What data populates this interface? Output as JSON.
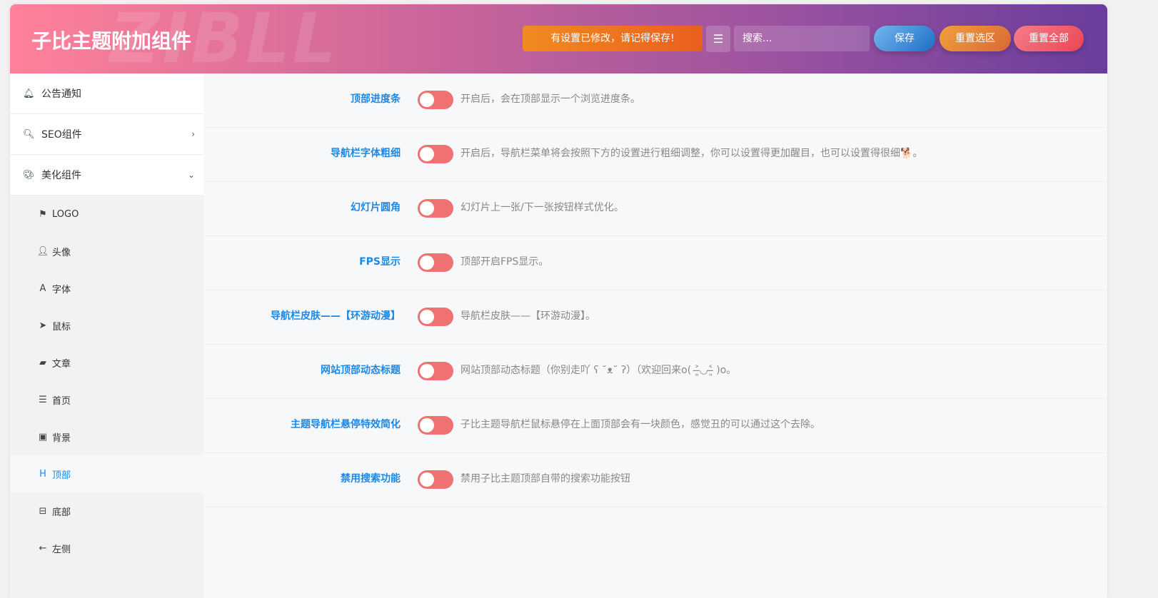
{
  "header": {
    "title": "子比主题附加组件",
    "watermark": "ZIBLL",
    "notice": "有设置已修改，请记得保存!",
    "search_placeholder": "搜索...",
    "save": "保存",
    "reset_section": "重置选区",
    "reset_all": "重置全部"
  },
  "sidebar": {
    "top": [
      {
        "label": "公告通知",
        "icon": "bell-icon"
      },
      {
        "label": "SEO组件",
        "icon": "search-icon"
      },
      {
        "label": "美化组件",
        "icon": "palette-icon"
      }
    ],
    "sub": [
      {
        "label": "LOGO",
        "icon": "flag-icon"
      },
      {
        "label": "头像",
        "icon": "user-icon"
      },
      {
        "label": "字体",
        "icon": "font-icon"
      },
      {
        "label": "鼠标",
        "icon": "cursor-icon"
      },
      {
        "label": "文章",
        "icon": "book-icon"
      },
      {
        "label": "首页",
        "icon": "indent-icon"
      },
      {
        "label": "背景",
        "icon": "image-icon"
      },
      {
        "label": "顶部",
        "icon": "header-icon",
        "active": true
      },
      {
        "label": "底部",
        "icon": "footer-icon"
      },
      {
        "label": "左侧",
        "icon": "arrow-left-icon"
      }
    ]
  },
  "settings": [
    {
      "label": "顶部进度条",
      "desc": "开启后，会在顶部显示一个浏览进度条。",
      "on": false
    },
    {
      "label": "导航栏字体粗细",
      "desc": "开启后，导航栏菜单将会按照下方的设置进行粗细调整，你可以设置得更加醒目，也可以设置得很细🐕。",
      "on": false
    },
    {
      "label": "幻灯片圆角",
      "desc": "幻灯片上一张/下一张按钮样式优化。",
      "on": false
    },
    {
      "label": "FPS显示",
      "desc": "顶部开启FPS显示。",
      "on": false
    },
    {
      "label": "导航栏皮肤——【环游动漫】",
      "desc": "导航栏皮肤——【环游动漫】。",
      "on": false
    },
    {
      "label": "网站顶部动态标题",
      "desc": "网站顶部动态标题（你别走吖 ʕ ˘ᴥ˘ ʔ）（欢迎回来o( ˃̶͈◡˂̶͈ )o。",
      "on": false
    },
    {
      "label": "主题导航栏悬停特效简化",
      "desc": "子比主题导航栏鼠标悬停在上面顶部会有一块颜色，感觉丑的可以通过这个去除。",
      "on": false
    },
    {
      "label": "禁用搜索功能",
      "desc": "禁用子比主题顶部自带的搜索功能按钮",
      "on": false
    }
  ]
}
